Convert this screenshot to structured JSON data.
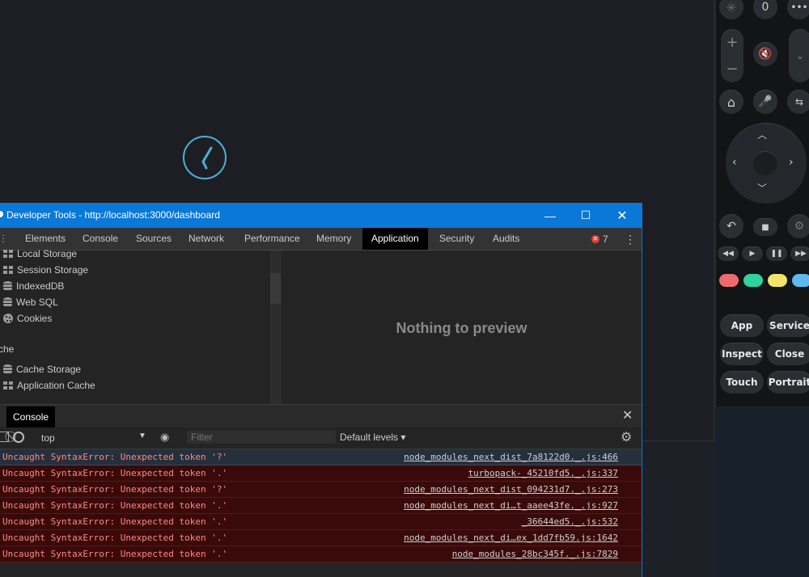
{
  "devtools": {
    "title": "Developer Tools - http://localhost:3000/dashboard",
    "tabs": [
      "Elements",
      "Console",
      "Sources",
      "Network",
      "Performance",
      "Memory",
      "Application",
      "Security",
      "Audits"
    ],
    "active_tab": "Application",
    "error_count": "7",
    "sidebar": {
      "items": [
        "Local Storage",
        "Session Storage",
        "IndexedDB",
        "Web SQL",
        "Cookies"
      ],
      "section": "che",
      "cache_items": [
        "Cache Storage",
        "Application Cache"
      ]
    },
    "preview_message": "Nothing to preview",
    "drawer_tab": "Console",
    "console": {
      "context": "top",
      "filter_placeholder": "Filter",
      "levels": "Default levels ▾",
      "messages": [
        {
          "text": "Uncaught SyntaxError: Unexpected token '?'",
          "source": "node_modules_next_dist_7a8122d0._.js:466"
        },
        {
          "text": "Uncaught SyntaxError: Unexpected token '.'",
          "source": "turbopack-_45210fd5._.js:337"
        },
        {
          "text": "Uncaught SyntaxError: Unexpected token '?'",
          "source": "node_modules_next_dist_094231d7._.js:273"
        },
        {
          "text": "Uncaught SyntaxError: Unexpected token '.'",
          "source": "node_modules_next_di…t_aaee43fe._.js:927"
        },
        {
          "text": "Uncaught SyntaxError: Unexpected token '.'",
          "source": "_36644ed5._.js:532"
        },
        {
          "text": "Uncaught SyntaxError: Unexpected token '.'",
          "source": "node_modules_next_di…ex_1dd7fb59.js:1642"
        },
        {
          "text": "Uncaught SyntaxError: Unexpected token '.'",
          "source": "node_modules_28bc345f._.js:7829"
        }
      ]
    }
  },
  "remote": {
    "zero_label": "0",
    "buttons": [
      "App",
      "Service",
      "Inspect",
      "Close",
      "Touch",
      "Portrait"
    ],
    "colors": [
      "#ef6b6b",
      "#2fd3a0",
      "#f2e36a",
      "#5fb8ee"
    ]
  }
}
